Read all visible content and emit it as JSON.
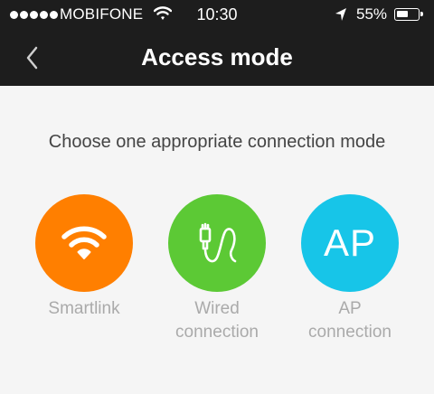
{
  "status_bar": {
    "carrier": "MOBIFONE",
    "time": "10:30",
    "battery": "55%",
    "battery_level": 0.55
  },
  "header": {
    "title": "Access mode",
    "back_icon": "chevron-left-icon"
  },
  "prompt": "Choose one appropriate connection mode",
  "options": [
    {
      "label_line1": "Smartlink",
      "label_line2": "",
      "icon": "wifi-icon",
      "color": "#ff7f00"
    },
    {
      "label_line1": "Wired",
      "label_line2": "connection",
      "icon": "cable-icon",
      "color": "#5cc935"
    },
    {
      "label_line1": "AP",
      "label_line2": "connection",
      "icon_text": "AP",
      "color": "#17c5e8"
    }
  ],
  "colors": {
    "header_bg": "#1d1d1d",
    "background": "#f5f5f5",
    "label_gray": "#aaaaaa"
  }
}
